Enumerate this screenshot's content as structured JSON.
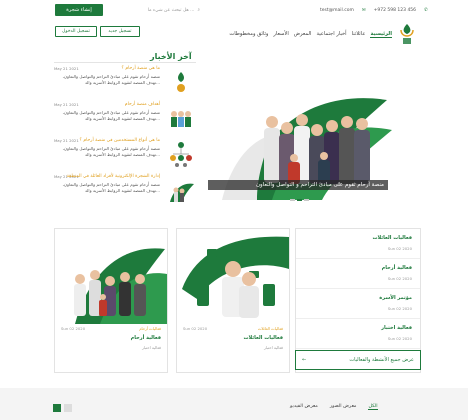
{
  "topbar": {
    "cta_label": "إنشاء شجرة",
    "search_placeholder": "هل تبحث عن شيء ما ...",
    "email": "test@mail.com",
    "phone": "+972 598 123 456"
  },
  "nav": {
    "items": [
      "الرئيسية",
      "عائلاتنا",
      "أخبار اجتماعية",
      "المعرض",
      "الأسعار",
      "وثائق ومخطوطات"
    ],
    "register_label": "تسجيل جديد",
    "login_label": "تسجيل الدخول"
  },
  "hero": {
    "caption": "منصة أرحام تقوم على مبادئ التراحم و التواصل والتعاون"
  },
  "news": {
    "title": "آخر الأخبار",
    "items": [
      {
        "date": "May 21 2021",
        "headline": "ما هي منصة أرحام ؟",
        "body": "منصة أرحام تقوم على مبادئ التراحم والتواصل والتعاون، تهدف المنصة لتقوية الروابط الأسرية والد..."
      },
      {
        "date": "May 21 2021",
        "headline": "أهداف منصة أرحام",
        "body": "منصة أرحام تقوم على مبادئ التراحم والتواصل والتعاون، تهدف المنصة لتقوية الروابط الأسرية والد..."
      },
      {
        "date": "May 21 2021",
        "headline": "ما هي أنواع المستخدمين في منصة أرحام ؟",
        "body": "منصة أرحام تقوم على مبادئ التراحم والتواصل والتعاون، تهدف المنصة لتقوية الروابط الأسرية والد..."
      },
      {
        "date": "May 21 2021",
        "headline": "إدارة الشجرة الإلكترونية لأفراد العائلة في المنطقة",
        "body": "منصة أرحام تقوم على مبادئ التراحم والتواصل والتعاون، تهدف المنصة لتقوية الروابط الأسرية والد..."
      }
    ]
  },
  "activities": {
    "items": [
      {
        "title": "فعاليات العائلات",
        "date": "Sun 02 2020"
      },
      {
        "title": "فعالية أرحام",
        "date": "Sun 02 2020"
      },
      {
        "title": "مؤتمر الأسرة",
        "date": "Sun 02 2020"
      },
      {
        "title": "فعالية اختبار",
        "date": "Sun 02 2020"
      }
    ],
    "all_label": "عرض جميع الأنشطة والفعاليات",
    "arrow": "←"
  },
  "cards": [
    {
      "date": "Sun 02 2020",
      "category": "فعاليات العائلات",
      "title": "فعاليات العائلات",
      "sub": "فعالية اختبار"
    },
    {
      "date": "Sun 02 2020",
      "category": "فعاليات أرحام",
      "title": "فعالية أرحام",
      "sub": "فعالية اختبار"
    }
  ],
  "footer": {
    "tabs": [
      "الكل",
      "معرض الصور",
      "معرض الفيديو"
    ]
  },
  "colors": {
    "brand": "#1e7a3c",
    "accent": "#e0a020"
  }
}
